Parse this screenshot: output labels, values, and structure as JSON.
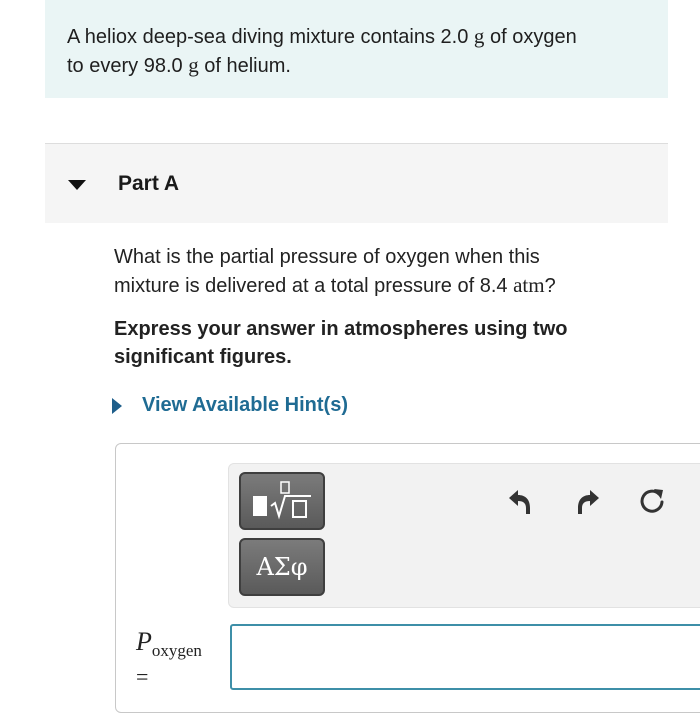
{
  "intro": {
    "line1_a": "A heliox deep-sea diving mixture contains 2.0 ",
    "line1_unit": "g",
    "line1_b": " of oxygen",
    "line2_a": "to every 98.0 ",
    "line2_unit": "g",
    "line2_b": " of helium."
  },
  "part": {
    "title": "Part A"
  },
  "question": {
    "line1": "What is the partial pressure of oxygen when this",
    "line2_a": "mixture is delivered at a total pressure of 8.4 ",
    "line2_unit": "atm",
    "line2_b": "?"
  },
  "instruction": {
    "text": "Express your answer in atmospheres using two significant figures."
  },
  "hint": {
    "label": "View Available Hint(s)"
  },
  "toolbar": {
    "symbols_label": "ΑΣφ"
  },
  "answer": {
    "variable": "P",
    "subscript": "oxygen",
    "equals": "=",
    "value": ""
  },
  "colors": {
    "intro_bg": "#eaf5f5",
    "link": "#1f6b93",
    "input_border": "#3e8fa8"
  }
}
